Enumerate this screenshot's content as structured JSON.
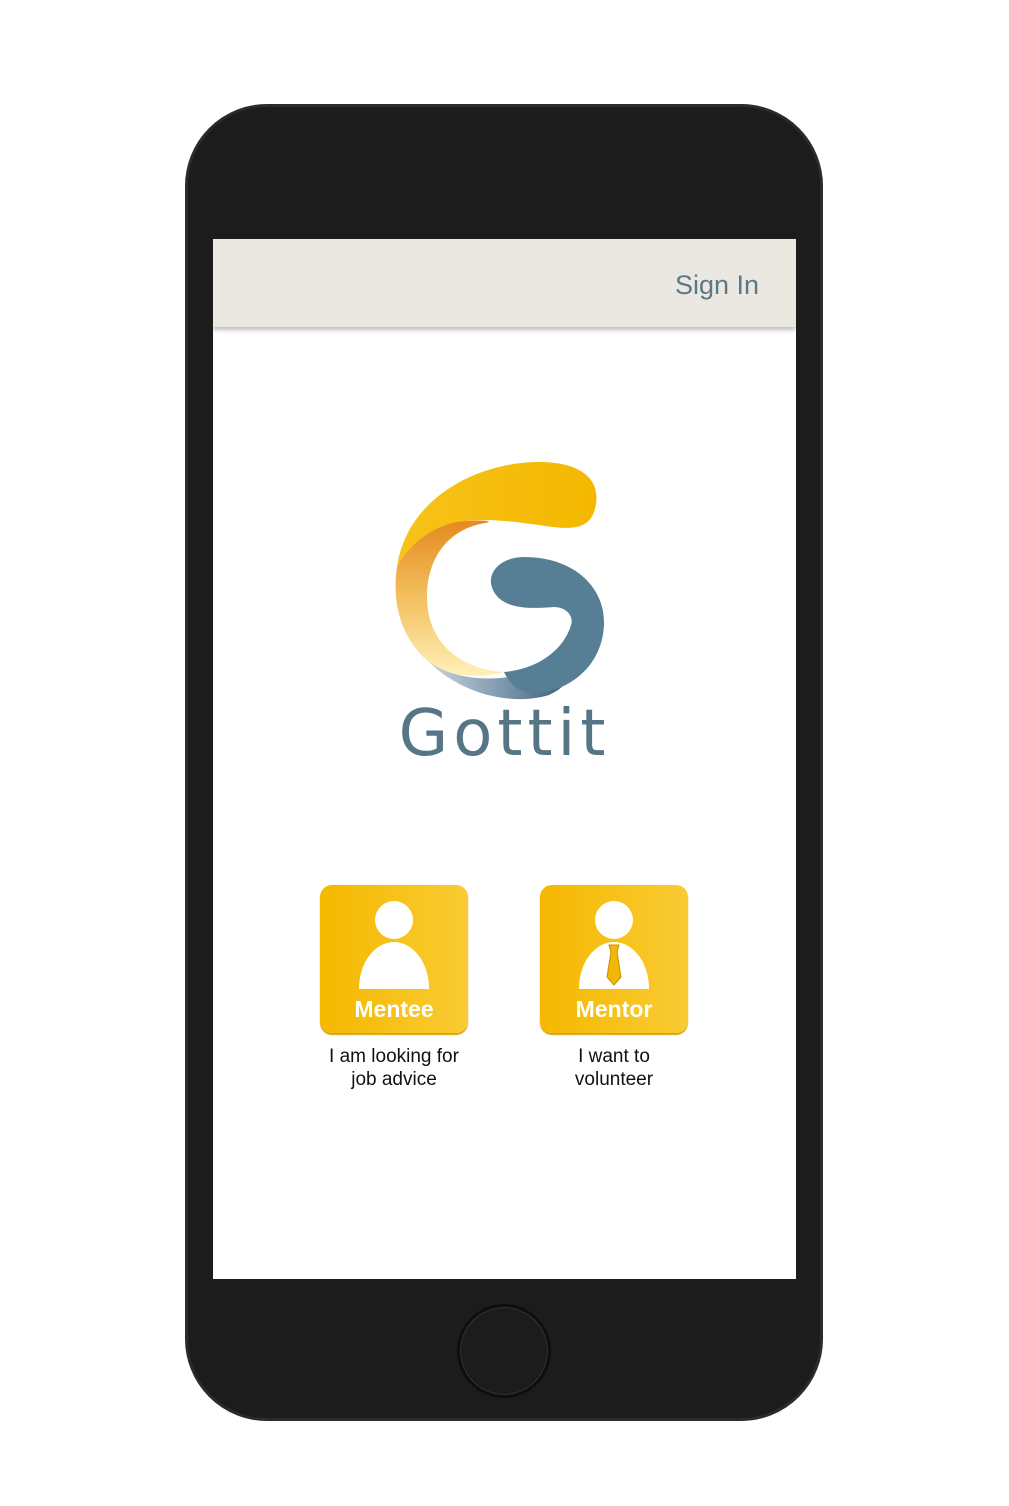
{
  "header": {
    "sign_in_label": "Sign In"
  },
  "brand": {
    "name": "Gottit"
  },
  "roles": [
    {
      "label": "Mentee",
      "description": "I am looking for\njob advice",
      "icon": "person-icon"
    },
    {
      "label": "Mentor",
      "description": "I want to\nvolunteer",
      "icon": "person-with-tie-icon"
    }
  ],
  "colors": {
    "accent_yellow": "#f5b800",
    "brand_blue": "#567585",
    "header_bg": "#ebe8e1",
    "phone_body": "#1c1c1c"
  }
}
